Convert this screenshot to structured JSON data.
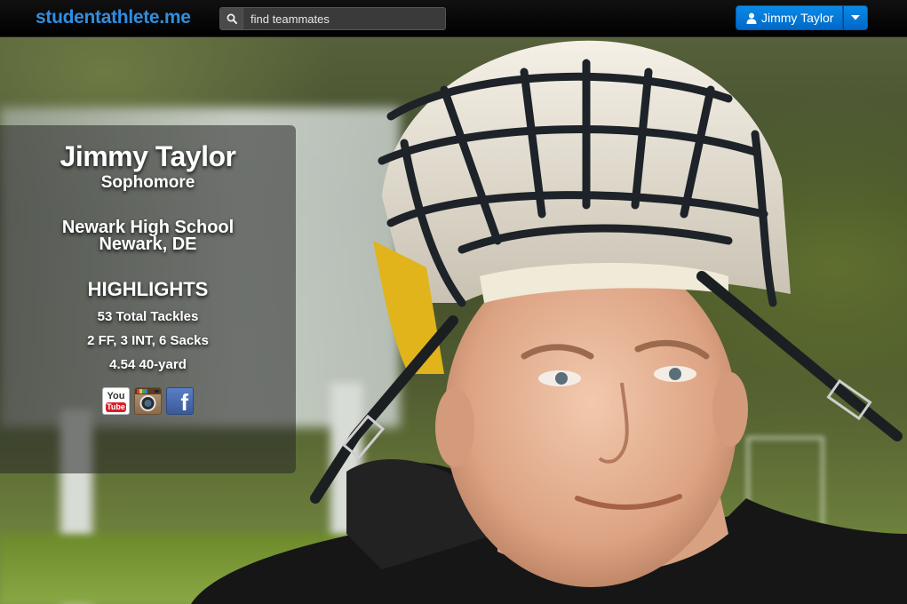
{
  "navbar": {
    "brand": "studentathlete.me",
    "search": {
      "placeholder": "find teammates",
      "value": ""
    },
    "user": {
      "name": "Jimmy Taylor"
    }
  },
  "profile": {
    "name": "Jimmy Taylor",
    "grade": "Sophomore",
    "school": "Newark High School",
    "location": "Newark, DE",
    "highlights_title": "HIGHLIGHTS",
    "highlights": [
      "53 Total Tackles",
      "2 FF, 3 INT, 6 Sacks",
      "4.54 40-yard"
    ],
    "social": [
      {
        "icon": "youtube-icon",
        "label_top": "You",
        "label_bottom": "Tube"
      },
      {
        "icon": "instagram-icon"
      },
      {
        "icon": "facebook-icon",
        "label": "f"
      }
    ]
  },
  "colors": {
    "brand": "#2f8ee0",
    "primary_button": "#0a7bdc",
    "navbar": "#000000"
  }
}
